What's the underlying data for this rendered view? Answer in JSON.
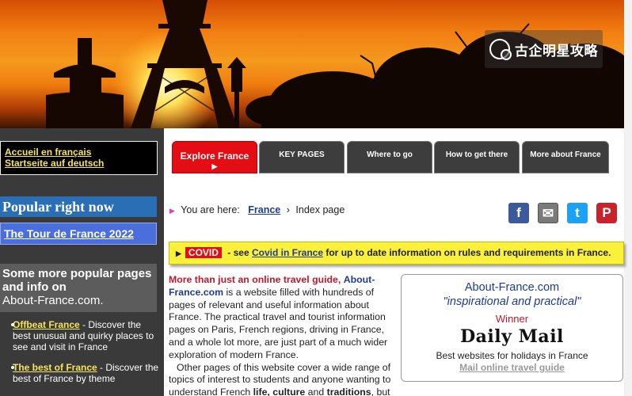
{
  "watermark": {
    "text": "古企明星攻略",
    "icon": "camera-badge-icon"
  },
  "sidebar": {
    "language_links": [
      "Accueil en français",
      "Startseite auf deutsch"
    ],
    "popular_heading": "Popular right now",
    "popular_link": "The Tour de France 2022",
    "more_heading_bold": "Some more popular pages and info on",
    "more_heading_site": "About-France.com.",
    "items": [
      {
        "link": "Offbeat France",
        "text": " - Discover the best unusual and quirky places to see and visit in France"
      },
      {
        "link": "The best of France",
        "text": " - Discover the best of France by theme"
      }
    ]
  },
  "tabs": [
    {
      "label": "Explore France",
      "arrow": "▶",
      "active": true
    },
    {
      "label": "KEY PAGES",
      "active": false
    },
    {
      "label": "Where to go",
      "active": false
    },
    {
      "label": "How to get there",
      "active": false
    },
    {
      "label": "More about France",
      "active": false
    }
  ],
  "breadcrumb": {
    "marker": "▶",
    "prefix": "You are here:",
    "link": "France",
    "separator": "›",
    "current": "Index page"
  },
  "social": {
    "facebook": "f",
    "email": "✉",
    "twitter": "t",
    "pinterest": "P"
  },
  "covid": {
    "pointer": "▶",
    "badge": "COVID",
    "pre_text": "- see",
    "link": "Covid in France",
    "post_text": "for up to date information on rules and requirements in France."
  },
  "intro": {
    "lead": "More than just an online travel guide,",
    "site": "About-France.com",
    "p1_rest": " is a website filled with hundreds of pages of relevant and useful information about France. The practical travel and tourist information pages on Paris, French regions, driving in France, and a whole lot more, are just part of a much wider exploration of modern France.",
    "p2_start": "Other pages of this website cover a wide range of topics of interest to students and anyone wanting to understand French ",
    "p2_bold1": "life, culture",
    "p2_and": " and  ",
    "p2_bold2": "traditions",
    "p2_end": ", but"
  },
  "award": {
    "site": "About-France.com",
    "quote": "\"inspirational and practical\"",
    "winner": "Winner",
    "paper": "Daily Mail",
    "description": "Best websites for holidays in France",
    "link": "Mail online travel guide"
  }
}
